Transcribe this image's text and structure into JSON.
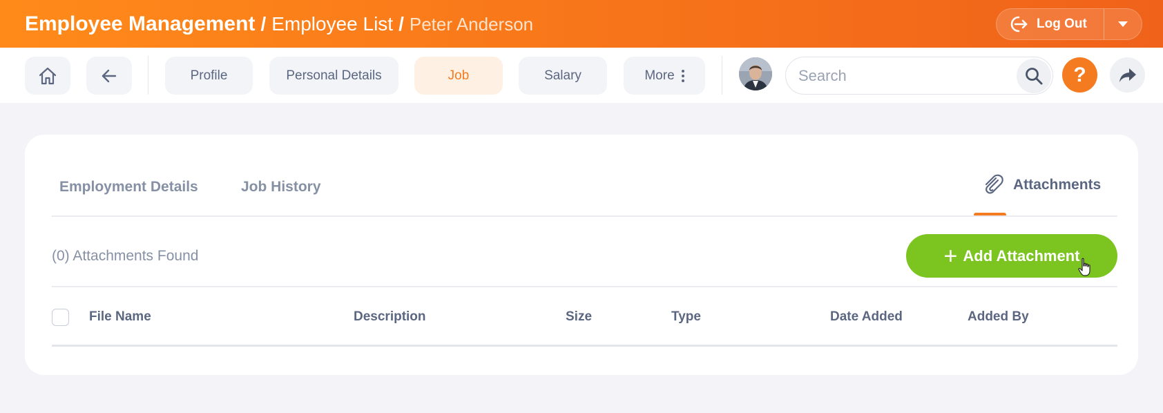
{
  "header": {
    "breadcrumb_root": "Employee Management",
    "separator": "/",
    "breadcrumb_mid": "Employee List",
    "breadcrumb_current": "Peter Anderson",
    "logout_label": "Log Out"
  },
  "toolbar": {
    "tabs": [
      {
        "label": "Profile"
      },
      {
        "label": "Personal Details"
      },
      {
        "label": "Job",
        "active": true
      },
      {
        "label": "Salary"
      },
      {
        "label": "More"
      }
    ],
    "search_placeholder": "Search",
    "help_label": "?"
  },
  "content": {
    "tabs": [
      {
        "label": "Employment Details"
      },
      {
        "label": "Job History"
      },
      {
        "label": "Attachments",
        "active": true
      }
    ],
    "found_text": "(0) Attachments Found",
    "add_button_label": "Add Attachment",
    "table": {
      "columns": [
        "File Name",
        "Description",
        "Size",
        "Type",
        "Date Added",
        "Added By"
      ],
      "rows": []
    }
  },
  "colors": {
    "brand_orange": "#f47b20",
    "add_green": "#7cc520",
    "text_slate": "#5b6680"
  }
}
